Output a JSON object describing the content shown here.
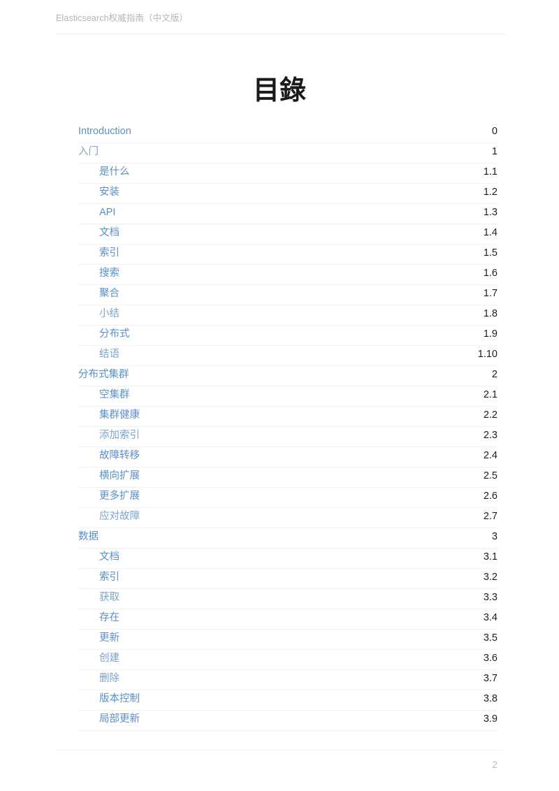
{
  "document": {
    "header_title": "Elasticsearch权威指南（中文版）",
    "toc_title": "目錄",
    "footer_page_number": "2",
    "accent_link_color": "#5a8fc8",
    "number_color": "#1d1d1d",
    "rule_color": "#f0f0f1",
    "header_text_color": "#b4b4b4",
    "footer_number_color": "#bcbcbc",
    "background_color": "#ffffff"
  },
  "toc": {
    "entries": [
      {
        "label": "Introduction",
        "number": "0",
        "level": 1,
        "faint": false
      },
      {
        "label": "入门",
        "number": "1",
        "level": 1,
        "faint": true
      },
      {
        "label": "是什么",
        "number": "1.1",
        "level": 2,
        "faint": false
      },
      {
        "label": "安装",
        "number": "1.2",
        "level": 2,
        "faint": false
      },
      {
        "label": "API",
        "number": "1.3",
        "level": 2,
        "faint": false
      },
      {
        "label": "文档",
        "number": "1.4",
        "level": 2,
        "faint": false
      },
      {
        "label": "索引",
        "number": "1.5",
        "level": 2,
        "faint": false
      },
      {
        "label": "搜索",
        "number": "1.6",
        "level": 2,
        "faint": false
      },
      {
        "label": "聚合",
        "number": "1.7",
        "level": 2,
        "faint": false
      },
      {
        "label": "小结",
        "number": "1.8",
        "level": 2,
        "faint": true
      },
      {
        "label": "分布式",
        "number": "1.9",
        "level": 2,
        "faint": false
      },
      {
        "label": "结语",
        "number": "1.10",
        "level": 2,
        "faint": true
      },
      {
        "label": "分布式集群",
        "number": "2",
        "level": 1,
        "faint": false
      },
      {
        "label": "空集群",
        "number": "2.1",
        "level": 2,
        "faint": false
      },
      {
        "label": "集群健康",
        "number": "2.2",
        "level": 2,
        "faint": false
      },
      {
        "label": "添加索引",
        "number": "2.3",
        "level": 2,
        "faint": true
      },
      {
        "label": "故障转移",
        "number": "2.4",
        "level": 2,
        "faint": false
      },
      {
        "label": "横向扩展",
        "number": "2.5",
        "level": 2,
        "faint": false
      },
      {
        "label": "更多扩展",
        "number": "2.6",
        "level": 2,
        "faint": false
      },
      {
        "label": "应对故障",
        "number": "2.7",
        "level": 2,
        "faint": true
      },
      {
        "label": "数据",
        "number": "3",
        "level": 1,
        "faint": false
      },
      {
        "label": "文档",
        "number": "3.1",
        "level": 2,
        "faint": false
      },
      {
        "label": "索引",
        "number": "3.2",
        "level": 2,
        "faint": false
      },
      {
        "label": "获取",
        "number": "3.3",
        "level": 2,
        "faint": true
      },
      {
        "label": "存在",
        "number": "3.4",
        "level": 2,
        "faint": false
      },
      {
        "label": "更新",
        "number": "3.5",
        "level": 2,
        "faint": false
      },
      {
        "label": "创建",
        "number": "3.6",
        "level": 2,
        "faint": true
      },
      {
        "label": "删除",
        "number": "3.7",
        "level": 2,
        "faint": true
      },
      {
        "label": "版本控制",
        "number": "3.8",
        "level": 2,
        "faint": false
      },
      {
        "label": "局部更新",
        "number": "3.9",
        "level": 2,
        "faint": false
      }
    ]
  }
}
